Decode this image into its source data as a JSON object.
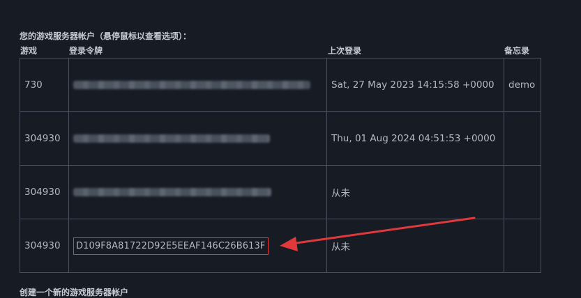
{
  "intro_text": "您的游戏服务器帐户（悬停鼠标以查看选项）：",
  "columns": {
    "game": "游戏",
    "token": "登录令牌",
    "last_login": "上次登录",
    "memo": "备忘录"
  },
  "rows": [
    {
      "game": "730",
      "token": "",
      "token_redacted": true,
      "last_login": "Sat, 27 May 2023 14:15:58 +0000",
      "memo": "demo"
    },
    {
      "game": "304930",
      "token": "",
      "token_redacted": true,
      "last_login": "Thu, 01 Aug 2024 04:51:53 +0000",
      "memo": ""
    },
    {
      "game": "304930",
      "token": "",
      "token_redacted": true,
      "last_login": "从未",
      "memo": ""
    },
    {
      "game": "304930",
      "token": "D109F8A81722D92E5EEAF146C26B613F",
      "token_redacted": false,
      "last_login": "从未",
      "memo": ""
    }
  ],
  "footer_text": "创建一个新的游戏服务器帐户",
  "colors": {
    "background": "#161b24",
    "border": "#4a5260",
    "highlight": "#e0393b"
  }
}
